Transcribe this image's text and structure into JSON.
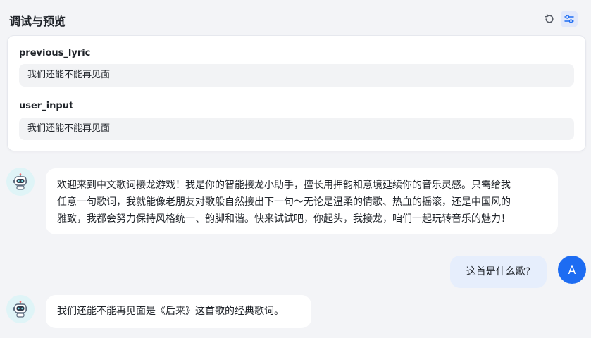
{
  "header": {
    "title": "调试与预览",
    "reset_icon": "refresh-icon",
    "settings_icon": "sliders-icon"
  },
  "variables": [
    {
      "label": "previous_lyric",
      "value": "我们还能不能再见面"
    },
    {
      "label": "user_input",
      "value": "我们还能不能再见面"
    }
  ],
  "messages": {
    "bot_welcome_lines": [
      "欢迎来到中文歌词接龙游戏！我是你的智能接龙小助手，擅长用押韵和意境延续你的音乐灵感。只需给我",
      "任意一句歌词，我就能像老朋友对歌般自然接出下一句～无论是温柔的情歌、热血的摇滚，还是中国风的",
      "雅致，我都会努力保持风格统一、韵脚和谐。快来试试吧，你起头，我接龙，咱们一起玩转音乐的魅力！"
    ],
    "user_question": "这首是什么歌?",
    "user_avatar_letter": "A",
    "bot_reply": "我们还能不能再见面是《后来》这首歌的经典歌词。"
  },
  "colors": {
    "accent": "#1d6cf2",
    "bot_avatar_bg": "#dff4f7",
    "user_bubble_bg": "#e6eefc",
    "page_bg": "#f3f4f7"
  }
}
